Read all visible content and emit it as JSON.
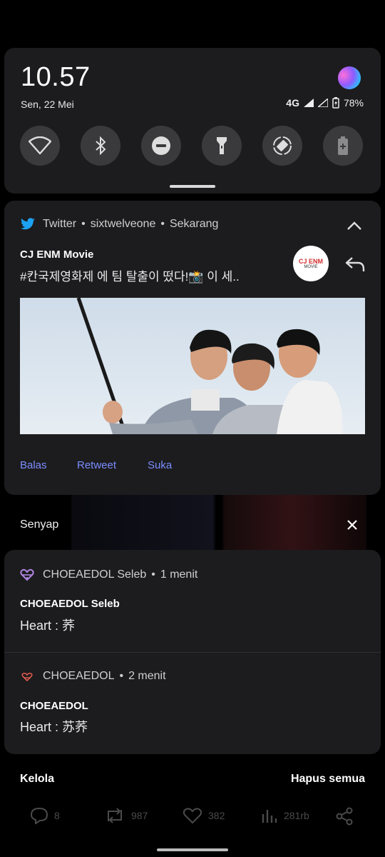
{
  "quick_settings": {
    "time": "10.57",
    "date": "Sen, 22 Mei",
    "network": "4G",
    "battery": "78%",
    "tiles": [
      "wifi-icon",
      "bluetooth-icon",
      "do-not-disturb-icon",
      "flashlight-icon",
      "auto-rotate-icon",
      "battery-saver-icon"
    ]
  },
  "twitter_notification": {
    "app": "Twitter",
    "account": "sixtwelveone",
    "time": "Sekarang",
    "title": "CJ ENM Movie",
    "text": "#칸국제영화제 에 팀 탈출이 떴다!📸 이 세..",
    "avatar_text_top": "CJ ENM",
    "avatar_text_bottom": "MOVIE",
    "actions": [
      "Balas",
      "Retweet",
      "Suka"
    ]
  },
  "mute_bar": {
    "label": "Senyap"
  },
  "choeaedol_notifications": [
    {
      "app": "CHOEAEDOL Seleb",
      "time": "1 menit",
      "title": "CHOEAEDOL Seleb",
      "text": "Heart : 荞",
      "color": "#b085e0"
    },
    {
      "app": "CHOEAEDOL",
      "time": "2 menit",
      "title": "CHOEAEDOL",
      "text": "Heart : 苏荞",
      "color": "#e0584e"
    }
  ],
  "footer": {
    "manage": "Kelola",
    "clear_all": "Hapus semua"
  },
  "background_tweet_stats": {
    "replies": "8",
    "retweets": "987",
    "likes": "382",
    "views": "281rb"
  },
  "colors": {
    "twitter_blue": "#1da1f2",
    "action_blue": "#7b8cff",
    "panel": "#1c1c1e"
  }
}
